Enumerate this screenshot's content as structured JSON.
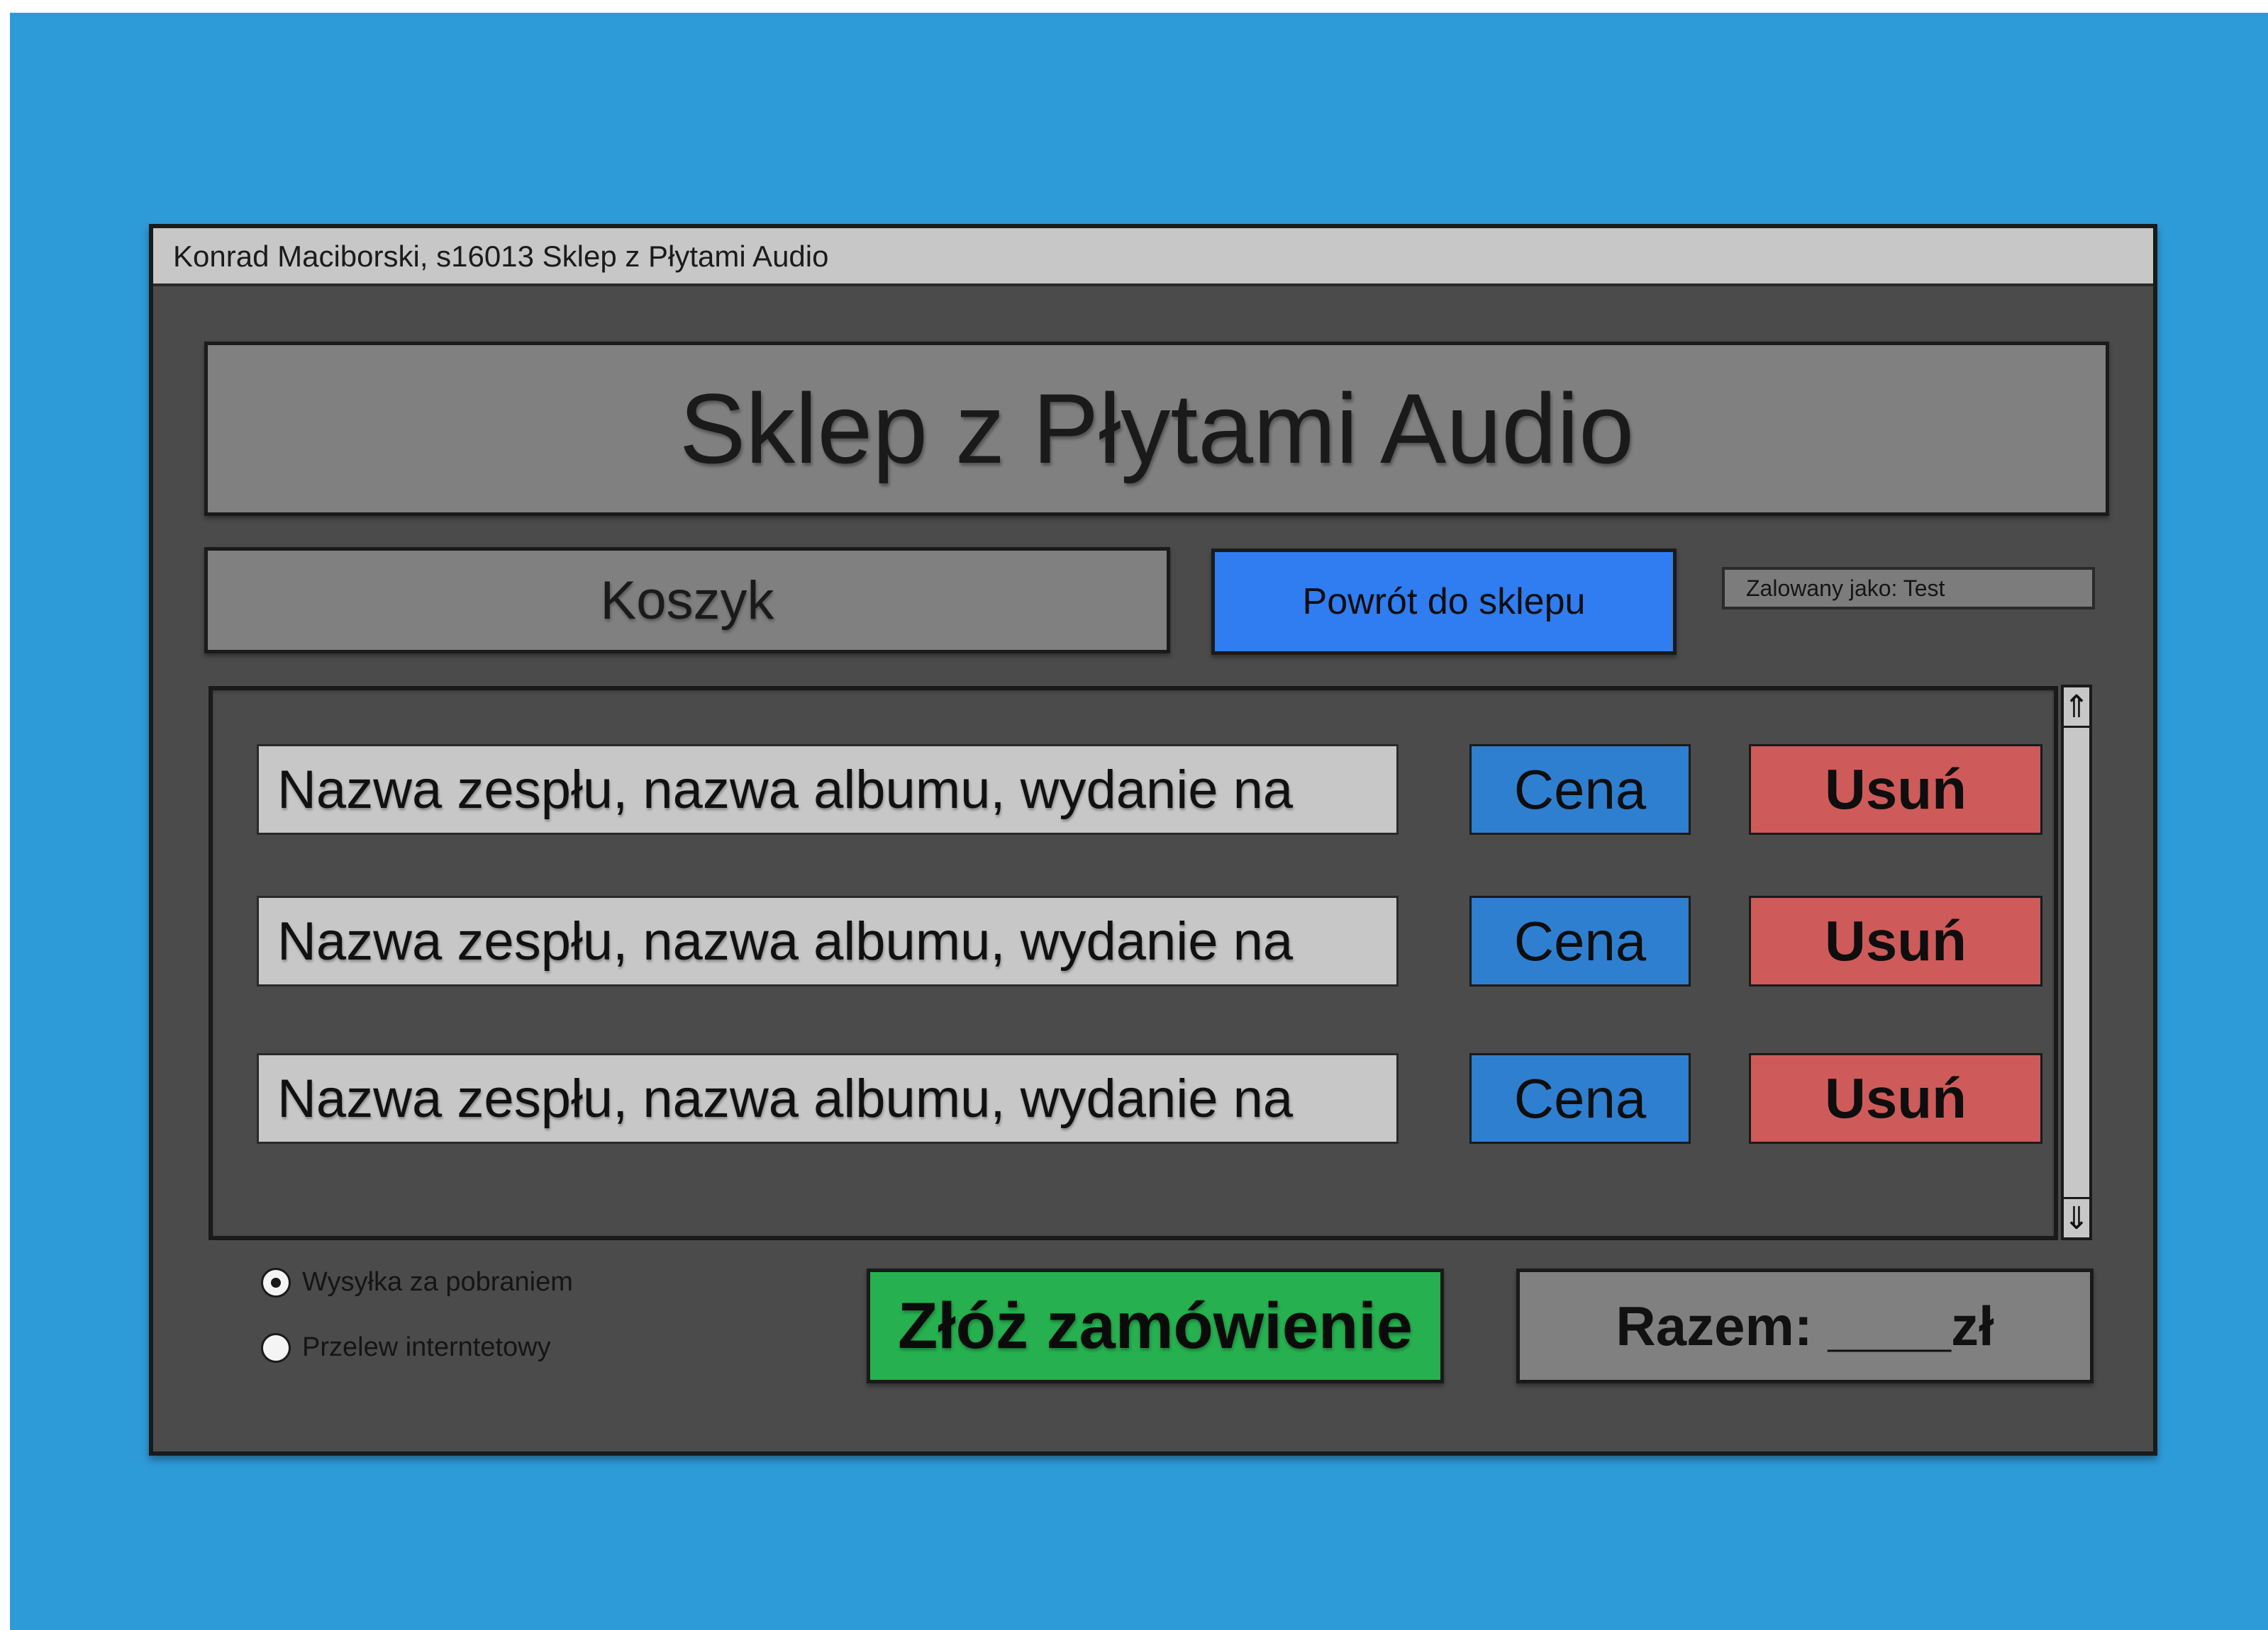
{
  "window": {
    "title": "Konrad Maciborski, s16013 Sklep z Płytami Audio"
  },
  "header": {
    "title": "Sklep z Płytami Audio"
  },
  "nav": {
    "section_label": "Koszyk",
    "back_button": "Powrót do sklepu",
    "logged_in": "Zalowany jako: Test"
  },
  "cart": {
    "items": [
      {
        "name": "Nazwa zespłu, nazwa albumu, wydanie na",
        "price": "Cena",
        "remove": "Usuń"
      },
      {
        "name": "Nazwa zespłu, nazwa albumu, wydanie na",
        "price": "Cena",
        "remove": "Usuń"
      },
      {
        "name": "Nazwa zespłu, nazwa albumu, wydanie na",
        "price": "Cena",
        "remove": "Usuń"
      }
    ]
  },
  "payment": {
    "options": [
      {
        "label": "Wysyłka za pobraniem",
        "selected": true
      },
      {
        "label": "Przelew interntetowy",
        "selected": false
      }
    ]
  },
  "actions": {
    "order_button": "Złóż zamówienie"
  },
  "summary": {
    "total": "Razem: ____zł"
  },
  "scrollbar": {
    "up_icon": "⇑",
    "down_icon": "⇓"
  },
  "colors": {
    "background": "#2e9bd9",
    "window": "#4b4b4b",
    "back_button": "#2f7df0",
    "price": "#2e7fd0",
    "remove": "#cf5a5a",
    "order": "#26b04f"
  }
}
